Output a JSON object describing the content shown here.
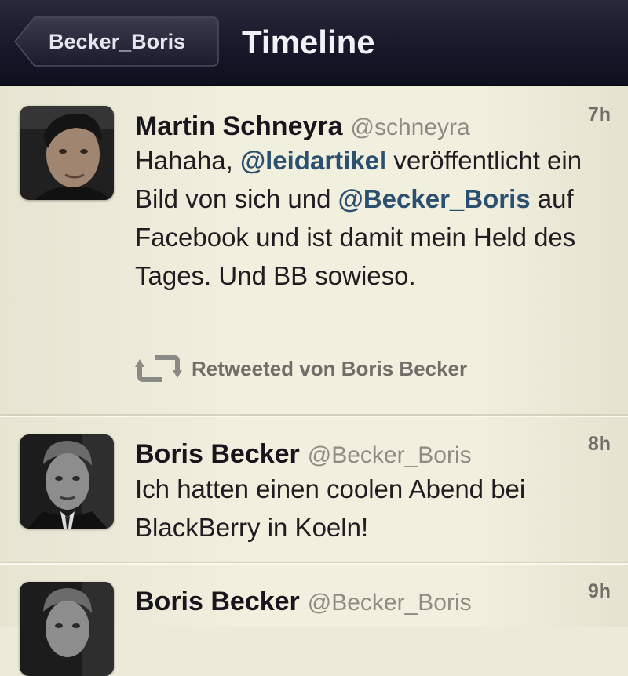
{
  "navbar": {
    "back_label": "Becker_Boris",
    "title": "Timeline"
  },
  "tweets": [
    {
      "author": "Martin Schneyra",
      "handle": "@schneyra",
      "time": "7h",
      "text": [
        {
          "t": "Hahaha, ",
          "mention": false
        },
        {
          "t": "@leidartikel",
          "mention": true
        },
        {
          "t": " veröffentlicht ein Bild von sich und ",
          "mention": false
        },
        {
          "t": "@Becker_Boris",
          "mention": true
        },
        {
          "t": " auf Facebook und ist damit mein Held des Tages. Und BB sowieso.",
          "mention": false
        }
      ],
      "retweeted_by": "Retweeted von Boris Becker"
    },
    {
      "author": "Boris Becker",
      "handle": "@Becker_Boris",
      "time": "8h",
      "text": [
        {
          "t": "Ich hatten einen coolen Abend bei BlackBerry in Koeln!",
          "mention": false
        }
      ]
    },
    {
      "author": "Boris Becker",
      "handle": "@Becker_Boris",
      "time": "9h",
      "text": []
    }
  ],
  "icons": {
    "back": "back-arrow-icon",
    "retweet": "retweet-icon"
  },
  "colors": {
    "navbar": "#17182a",
    "background": "#f1f0df",
    "mention": "#2b4f6e",
    "meta_text": "#8d8c84"
  }
}
